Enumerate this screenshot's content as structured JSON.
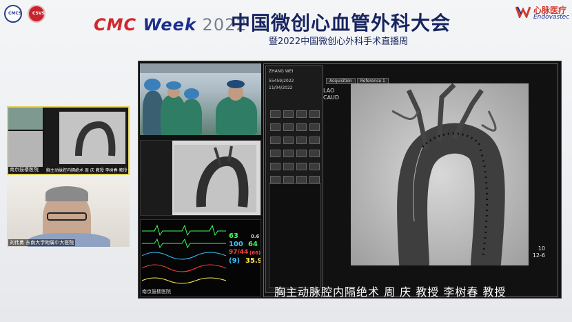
{
  "header": {
    "logo_left_1_text": "CMCS",
    "logo_left_2_text": "CSVS",
    "brand_part1": "CMC ",
    "brand_part2": "Week",
    "brand_year": " 2022",
    "conference_title": "中国微创心血管外科大会",
    "conference_subtitle": "暨2022中国微创心外科手术直播周",
    "sponsor_cn": "心脉医疗",
    "sponsor_en": "Endovastec",
    "colors": {
      "brand_red": "#d2262c",
      "brand_blue": "#1c2f8c",
      "title_navy": "#17245f"
    }
  },
  "remote_panels": {
    "top_label": "南京鼓楼医院",
    "top_inner_caption": "胸主动脉腔内隔绝术 周 庆 教授 李树春 教授",
    "bottom_label": "刘伟勇 东南大学附属中大医院"
  },
  "monitor": {
    "caption": "南京鼓楼医院",
    "vitals": [
      {
        "value": "63",
        "color": "#3cff5a"
      },
      {
        "value": "0.6",
        "color": "#cfcfcf"
      },
      {
        "value": "100",
        "color": "#39c3ff"
      },
      {
        "value": "64",
        "color": "#3cff5a"
      },
      {
        "value": "97/44",
        "color": "#ff4040"
      },
      {
        "value": "(66)",
        "color": "#ff4040"
      },
      {
        "value": "(9)",
        "color": "#39c3ff"
      },
      {
        "value": "35.9",
        "color": "#ffe94a"
      }
    ]
  },
  "workstation": {
    "patient_name": "ZHANG WEI",
    "patient_id": "55459/2022",
    "exam_date": "11/04/2022",
    "tab_acquisition": "Acquisition",
    "tab_reference": "Reference 1",
    "view_lao": "LAO",
    "view_caud": "CAUD",
    "frame_line1": "10",
    "frame_line2": "12-6"
  },
  "main_caption": "胸主动脉腔内隔绝术  周  庆  教授  李树春  教授"
}
